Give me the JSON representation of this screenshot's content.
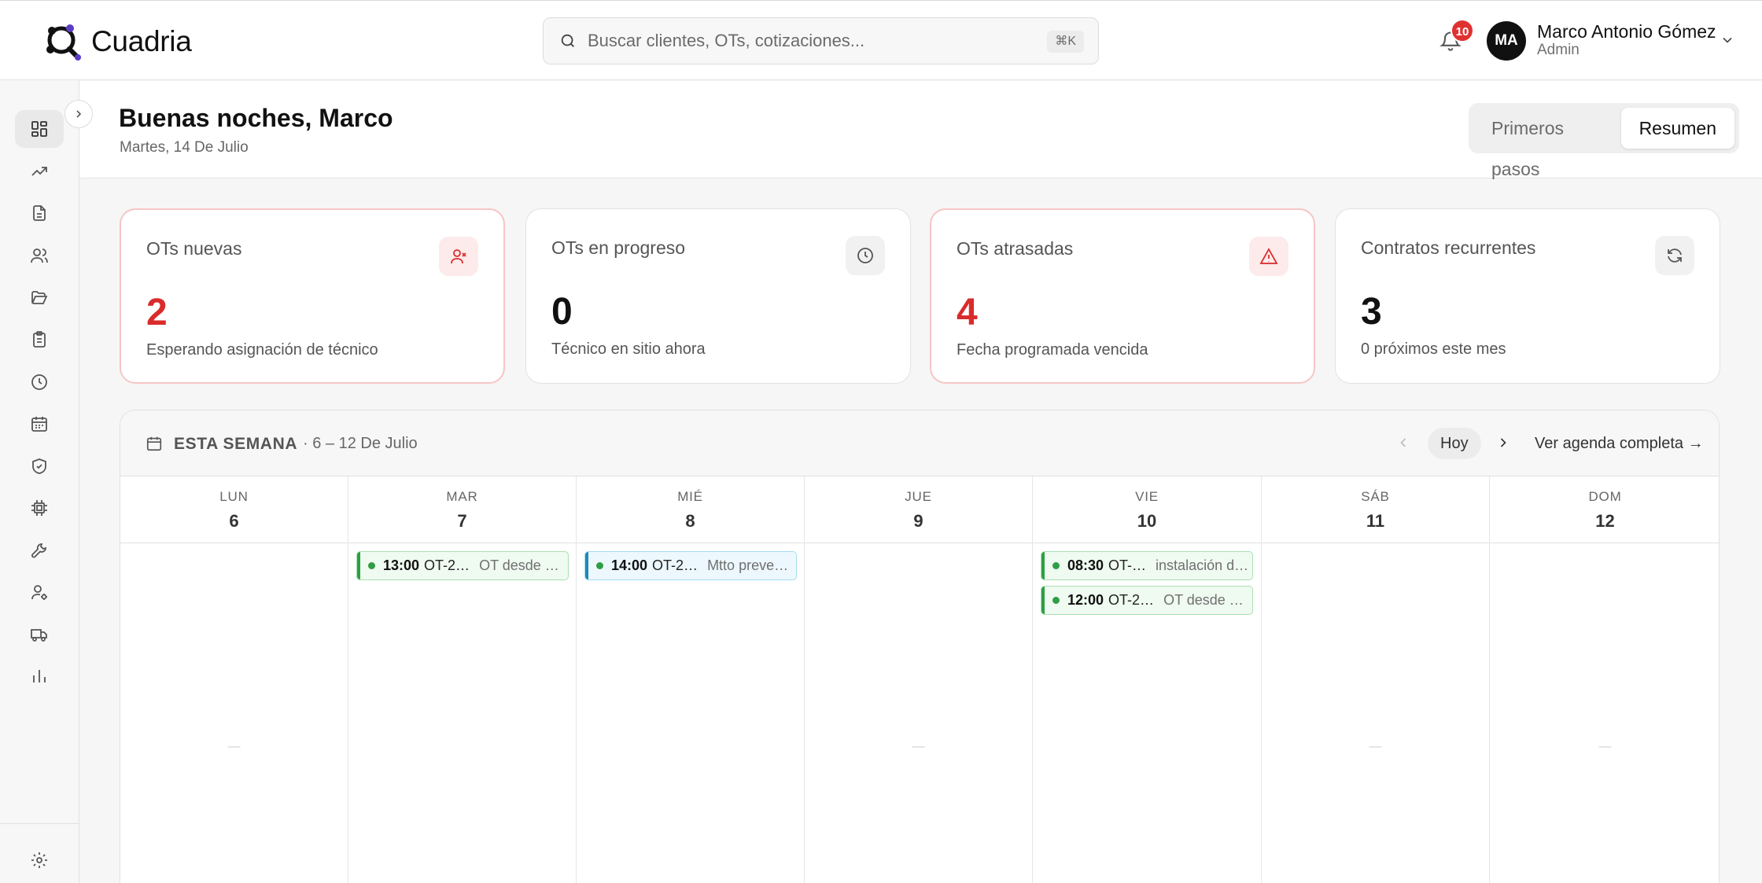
{
  "app": {
    "brand": "Cuadria"
  },
  "search": {
    "placeholder": "Buscar clientes, OTs, cotizaciones...",
    "shortcut": "⌘K"
  },
  "notifications": {
    "count": "10"
  },
  "user": {
    "initials": "MA",
    "name": "Marco Antonio Gómez",
    "role": "Admin"
  },
  "sidebar": {
    "items": [
      {
        "icon": "dashboard-icon",
        "active": true
      },
      {
        "icon": "trending-up-icon"
      },
      {
        "icon": "document-icon"
      },
      {
        "icon": "users-icon"
      },
      {
        "icon": "folder-open-icon"
      },
      {
        "icon": "clipboard-icon"
      },
      {
        "icon": "clock-icon"
      },
      {
        "icon": "calendar-icon"
      },
      {
        "icon": "shield-check-icon"
      },
      {
        "icon": "chip-icon"
      },
      {
        "icon": "wrench-icon"
      },
      {
        "icon": "user-cog-icon"
      },
      {
        "icon": "truck-icon"
      },
      {
        "icon": "bar-chart-icon"
      }
    ],
    "footer_icon": "settings-icon"
  },
  "page": {
    "greeting": "Buenas noches, Marco",
    "date": "Martes, 14 De Julio",
    "tabs": [
      {
        "label": "Primeros pasos"
      },
      {
        "label": "Resumen",
        "active": true
      }
    ]
  },
  "cards": [
    {
      "title": "OTs nuevas",
      "value": "2",
      "sub": "Esperando asignación de técnico",
      "icon": "user-x-icon",
      "alert": true
    },
    {
      "title": "OTs en progreso",
      "value": "0",
      "sub": "Técnico en sitio ahora",
      "icon": "clock-icon",
      "alert": false
    },
    {
      "title": "OTs atrasadas",
      "value": "4",
      "sub": "Fecha programada vencida",
      "icon": "alert-triangle-icon",
      "alert": true
    },
    {
      "title": "Contratos recurrentes",
      "value": "3",
      "sub": "0 próximos este mes",
      "icon": "refresh-icon",
      "alert": false
    }
  ],
  "calendar": {
    "title": "ESTA SEMANA",
    "range": "· 6 – 12 De Julio",
    "today_label": "Hoy",
    "full_agenda": "Ver agenda completa →",
    "empty_marker": "—",
    "days": [
      {
        "name": "LUN",
        "num": "6",
        "events": []
      },
      {
        "name": "MAR",
        "num": "7",
        "events": [
          {
            "time": "13:00",
            "code": "OT-2…",
            "title": "OT desde …",
            "color": "green"
          }
        ]
      },
      {
        "name": "MIÉ",
        "num": "8",
        "events": [
          {
            "time": "14:00",
            "code": "OT-2…",
            "title": "Mtto preve…",
            "color": "blue"
          }
        ]
      },
      {
        "name": "JUE",
        "num": "9",
        "events": []
      },
      {
        "name": "VIE",
        "num": "10",
        "events": [
          {
            "time": "08:30",
            "code": "OT-…",
            "title": "instalación d…",
            "color": "green"
          },
          {
            "time": "12:00",
            "code": "OT-2…",
            "title": "OT desde …",
            "color": "green"
          }
        ]
      },
      {
        "name": "SÁB",
        "num": "11",
        "events": []
      },
      {
        "name": "DOM",
        "num": "12",
        "events": []
      }
    ]
  },
  "colors": {
    "accent_red": "#d92b2b",
    "event_green": "#2f9e44",
    "event_blue": "#1c89b8",
    "badge_red": "#e03131"
  }
}
